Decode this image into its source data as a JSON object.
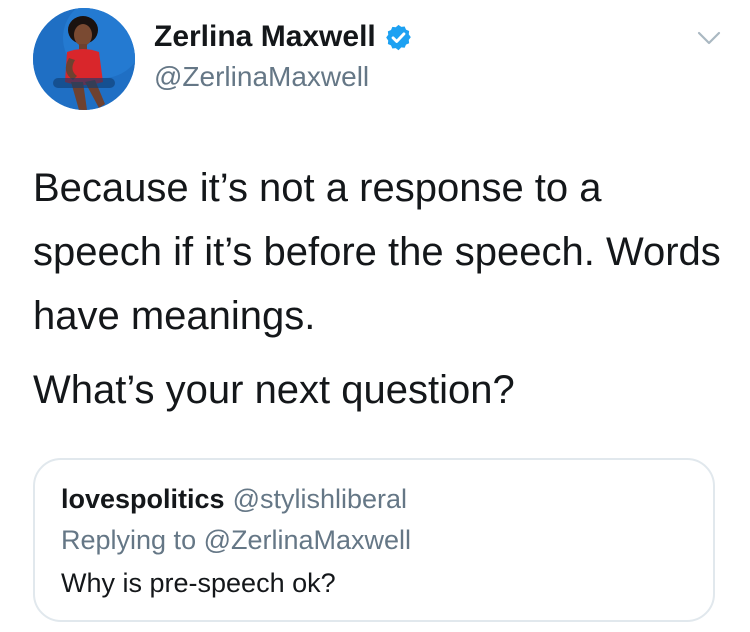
{
  "tweet": {
    "author": {
      "display_name": "Zerlina Maxwell",
      "handle": "@ZerlinaMaxwell",
      "verified": true,
      "avatar_icon": "profile-photo"
    },
    "menu_icon": "chevron-down-icon",
    "paragraphs": [
      "Because it’s not a response to a speech if it’s before the speech. Words have meanings.",
      "What’s your next question?"
    ]
  },
  "quoted_tweet": {
    "display_name": "lovespolitics",
    "handle": "@stylishliberal",
    "replying_to": "Replying to @ZerlinaMaxwell",
    "text": "Why is pre-speech ok?"
  },
  "colors": {
    "primary_text": "#14171a",
    "secondary_text": "#657786",
    "verified_blue": "#1da1f2",
    "card_border": "#e1e8ed"
  }
}
